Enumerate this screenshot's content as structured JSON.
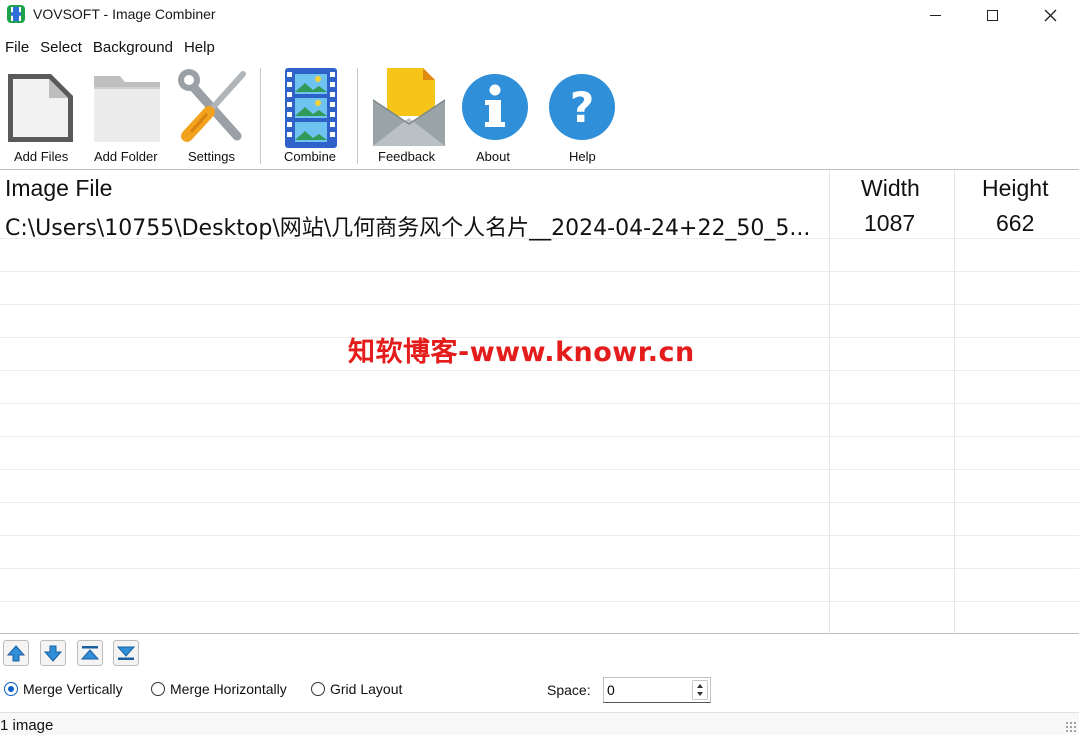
{
  "window": {
    "title": "VOVSOFT - Image Combiner"
  },
  "menu": {
    "items": [
      "File",
      "Select",
      "Background",
      "Help"
    ]
  },
  "toolbar": {
    "add_files": "Add Files",
    "add_folder": "Add Folder",
    "settings": "Settings",
    "combine": "Combine",
    "feedback": "Feedback",
    "about": "About",
    "help": "Help"
  },
  "table": {
    "columns": [
      "Image File",
      "Width",
      "Height"
    ],
    "rows": [
      {
        "file": "C:\\Users\\10755\\Desktop\\网站\\几何商务风个人名片__2024-04-24+22_50_5...",
        "width": "1087",
        "height": "662"
      }
    ]
  },
  "watermark": "知软博客-www.knowr.cn",
  "layout_options": {
    "merge_vertically": "Merge Vertically",
    "merge_horizontally": "Merge Horizontally",
    "grid_layout": "Grid Layout",
    "selected": "Merge Vertically"
  },
  "space": {
    "label": "Space:",
    "value": "0"
  },
  "status": {
    "text": "1 image"
  },
  "colors": {
    "accent": "#0b5fcb",
    "watermark": "#e41c1c",
    "icon_blue": "#2f8fd8"
  }
}
